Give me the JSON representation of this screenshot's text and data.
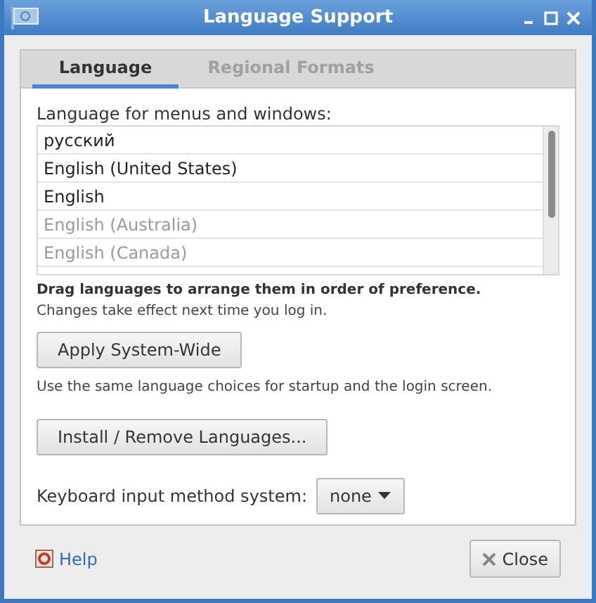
{
  "window": {
    "title": "Language Support"
  },
  "tabs": [
    {
      "label": "Language",
      "selected": true
    },
    {
      "label": "Regional Formats",
      "selected": false
    }
  ],
  "language_list": {
    "label": "Language for menus and windows:",
    "items": [
      {
        "label": "русский",
        "disabled": false
      },
      {
        "label": "English (United States)",
        "disabled": false
      },
      {
        "label": "English",
        "disabled": false
      },
      {
        "label": "English (Australia)",
        "disabled": true
      },
      {
        "label": "English (Canada)",
        "disabled": true
      }
    ]
  },
  "drag_hint": "Drag languages to arrange them in order of preference.",
  "changes_note": "Changes take effect next time you log in.",
  "apply_button": "Apply System-Wide",
  "apply_note": "Use the same language choices for startup and the login screen.",
  "install_button": "Install / Remove Languages...",
  "keyboard": {
    "label": "Keyboard input method system:",
    "value": "none"
  },
  "help_link": "Help",
  "close_button": "Close"
}
